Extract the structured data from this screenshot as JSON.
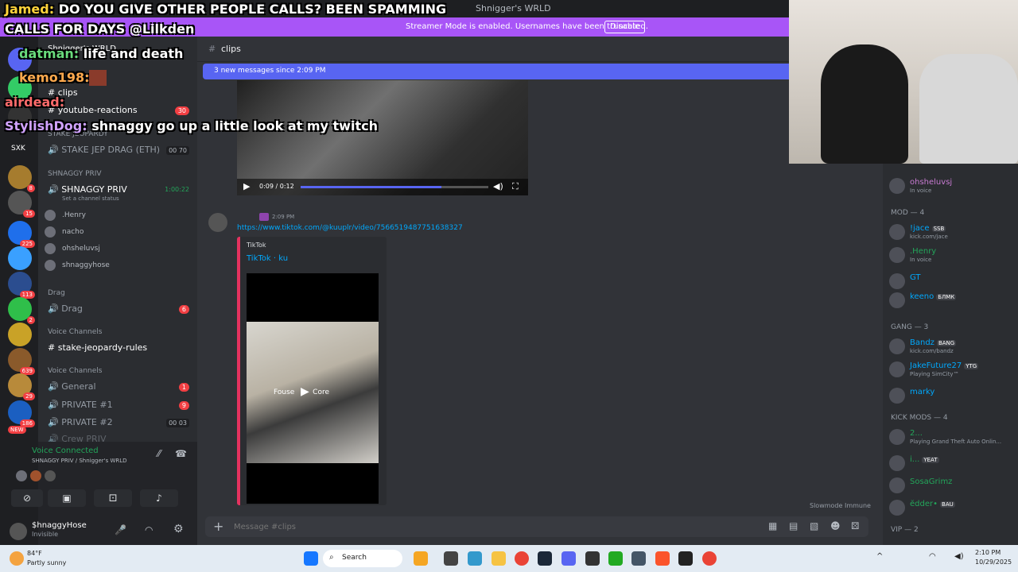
{
  "window": {
    "title": "Shnigger's WRLD"
  },
  "streamer_bar": {
    "message": "Streamer Mode is enabled. Usernames have been truncated.",
    "disable_label": "Disable"
  },
  "chat_overlay": [
    {
      "name": "Jamed:",
      "text": "DO YOU GIVE OTHER PEOPLE CALLS? BEEN SPAMMING",
      "text2": "CALLS FOR DAYS @Lilkden"
    },
    {
      "name": "datman:",
      "text": "life and death"
    },
    {
      "name": "kemo198:",
      "text": ""
    },
    {
      "name": "airdead:",
      "text": ""
    },
    {
      "name": "StylishDog:",
      "text": "shnaggy go up a little look at my twitch"
    }
  ],
  "server_list": {
    "dm_badges": [
      "8",
      "15",
      "225",
      "113",
      "2",
      "639",
      "29",
      "186"
    ],
    "new_label": "NEW",
    "short_label": "SXK"
  },
  "channel_sidebar": {
    "server_name": "Shnigger's WRLD",
    "channels": [
      {
        "name": "clips"
      },
      {
        "name": "youtube-reactions",
        "count": "30"
      }
    ],
    "categories": {
      "stake_jeopardy": "STAKE JEOPARDY",
      "shnaggy_priv": "SHNAGGY PRIV",
      "drag": "Drag",
      "voice1": "Voice Channels",
      "voice2": "Voice Channels"
    },
    "stake_drag": {
      "name": "STAKE JEP DRAG (ETH)",
      "a": "00",
      "b": "70"
    },
    "shnaggy_voice": {
      "name": "SHNAGGY PRIV",
      "timer": "1:00:22",
      "status": "Set a channel status"
    },
    "voice_users": [
      ".Henry",
      "nacho",
      "ohsheluvsj",
      "shnaggyhose"
    ],
    "drag_voice": {
      "name": "Drag",
      "count": "6"
    },
    "rules_channel": "stake-jeopardy-rules",
    "general": {
      "name": "General",
      "count": "1"
    },
    "private1": {
      "name": "PRIVATE #1",
      "count": "9"
    },
    "private2": {
      "name": "PRIVATE #2",
      "a": "00",
      "b": "03"
    },
    "partial": "Crew PRIV"
  },
  "voice_panel": {
    "status": "Voice Connected",
    "location": "SHNAGGY PRIV / Shnigger's WRLD"
  },
  "user_panel": {
    "name": "$hnaggyHose",
    "status": "Invisible"
  },
  "chat_header": {
    "channel": "clips"
  },
  "new_messages": {
    "text": "3 new messages since 2:09 PM"
  },
  "video_player": {
    "time": "0:09 / 0:12"
  },
  "message": {
    "time": "2:09 PM",
    "link": "https://www.tiktok.com/@kuuplr/video/7566519487751638327",
    "embed_provider": "TikTok",
    "embed_title": "TikTok · ku",
    "embed_caption": "Fouse        Core"
  },
  "slowmode": "Slowmode Immune",
  "composer": {
    "placeholder": "Message #clips"
  },
  "members": {
    "top_user": {
      "name": "ohsheluvsj",
      "sub": "In voice"
    },
    "mod_header": "MOD — 4",
    "mods": [
      {
        "name": "!jace",
        "tag": "SSB",
        "sub": "kick.com/jace"
      },
      {
        "name": ".Henry",
        "sub": "In voice"
      },
      {
        "name": "GT"
      },
      {
        "name": "keeno",
        "tag": "БЛМК",
        "sub": ""
      }
    ],
    "gang_header": "GANG — 3",
    "gang": [
      {
        "name": "Bandz",
        "tag": "BANG",
        "sub": "kick.com/bandz"
      },
      {
        "name": "JakeFuture27",
        "tag": "YTG",
        "sub": "Playing SimCity™"
      },
      {
        "name": "marky"
      }
    ],
    "kick_header": "KICK MODS — 4",
    "kick": [
      {
        "name": "2...",
        "sub": "Playing Grand Theft Auto Onlin..."
      },
      {
        "name": "i...",
        "tag": "YEAT"
      },
      {
        "name": "SosaGrimz"
      },
      {
        "name": "ĕdder•",
        "tag": "BAU"
      }
    ],
    "vip_header": "VIP — 2"
  },
  "taskbar": {
    "weather_temp": "84°F",
    "weather_desc": "Partly sunny",
    "search": "Search",
    "time": "2:10 PM",
    "date": "10/29/2025"
  },
  "colors": {
    "accent": "#5865f2",
    "streamer": "#a855f7",
    "online": "#23a55a",
    "danger": "#f23f43"
  }
}
